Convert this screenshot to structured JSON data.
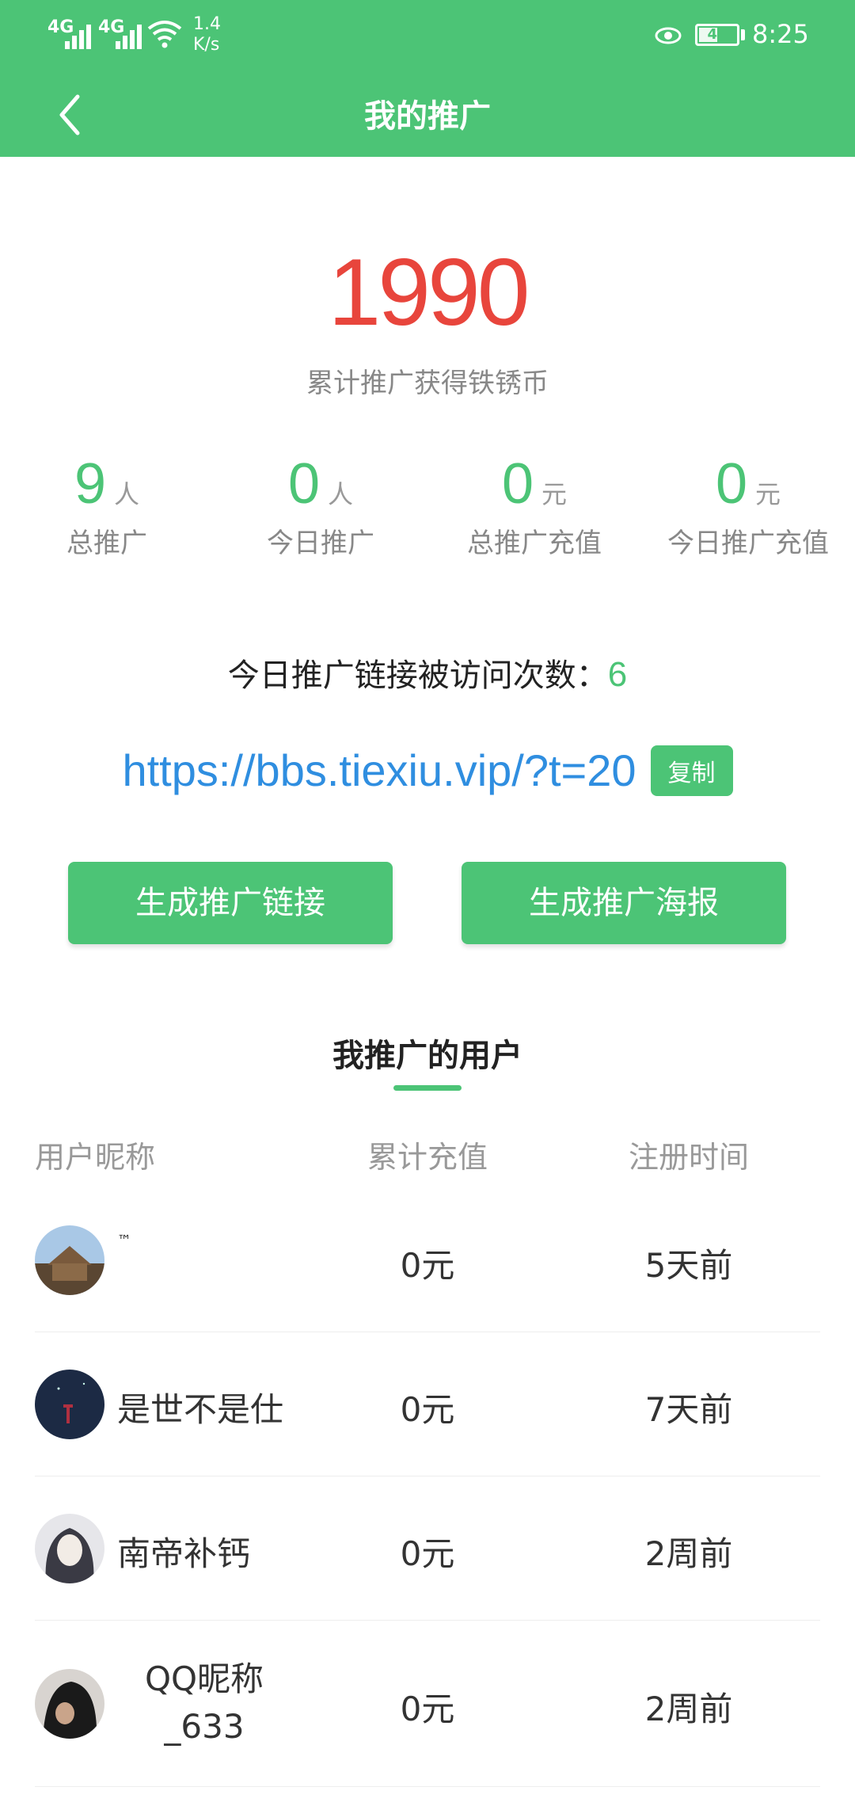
{
  "status_bar": {
    "network1": "4G",
    "network2": "4G",
    "speed_value": "1.4",
    "speed_unit": "K/s",
    "battery": "41",
    "time": "8:25"
  },
  "header": {
    "title": "我的推广"
  },
  "summary": {
    "total_coins": "1990",
    "total_coins_label": "累计推广获得铁锈币"
  },
  "stats": [
    {
      "value": "9",
      "unit": "人",
      "label": "总推广"
    },
    {
      "value": "0",
      "unit": "人",
      "label": "今日推广"
    },
    {
      "value": "0",
      "unit": "元",
      "label": "总推广充值"
    },
    {
      "value": "0",
      "unit": "元",
      "label": "今日推广充值"
    }
  ],
  "visits": {
    "label": "今日推广链接被访问次数：",
    "count": "6"
  },
  "link": {
    "url": "https://bbs.tiexiu.vip/?t=20",
    "copy_label": "复制"
  },
  "buttons": {
    "generate_link": "生成推广链接",
    "generate_poster": "生成推广海报"
  },
  "referred_users": {
    "title": "我推广的用户",
    "columns": [
      "用户昵称",
      "累计充值",
      "注册时间"
    ],
    "rows": [
      {
        "nickname": "™",
        "recharge": "0元",
        "registered": "5天前"
      },
      {
        "nickname": "是世不是仕",
        "recharge": "0元",
        "registered": "7天前"
      },
      {
        "nickname": "南帝补钙",
        "recharge": "0元",
        "registered": "2周前"
      },
      {
        "nickname": "QQ昵称_633",
        "recharge": "0元",
        "registered": "2周前"
      }
    ]
  },
  "colors": {
    "accent": "#4cc476",
    "coins": "#e8453c",
    "link": "#2f8ee0"
  }
}
